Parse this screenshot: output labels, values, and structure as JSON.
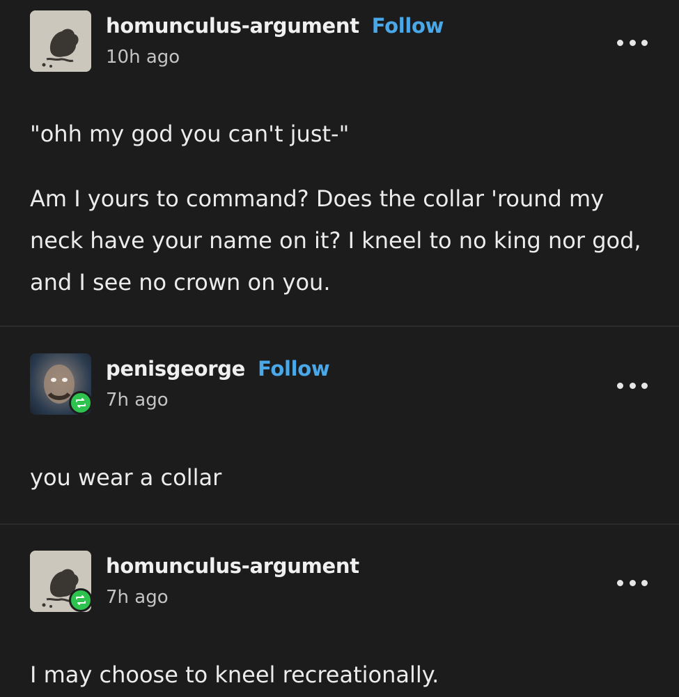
{
  "posts": [
    {
      "username": "homunculus-argument",
      "follow_label": "Follow",
      "time": "10h ago",
      "avatar": "sketch-avatar",
      "paragraphs": [
        "\"ohh my god you can't just-\"",
        "Am I yours to command? Does the collar 'round my neck have your name on it? I kneel to no king nor god, and I see no crown on you."
      ]
    },
    {
      "username": "penisgeorge",
      "follow_label": "Follow",
      "time": "7h ago",
      "avatar": "photo-avatar",
      "reblog_icon": "reblog-icon",
      "paragraphs": [
        "you wear a collar"
      ]
    },
    {
      "username": "homunculus-argument",
      "time": "7h ago",
      "avatar": "sketch-avatar",
      "reblog_icon": "reblog-icon",
      "paragraphs": [
        "I may choose to kneel recreationally."
      ]
    }
  ],
  "colors": {
    "background": "#1c1c1d",
    "follow": "#4aa8e8",
    "reblog_badge": "#2ec24f",
    "text": "#ececec"
  }
}
